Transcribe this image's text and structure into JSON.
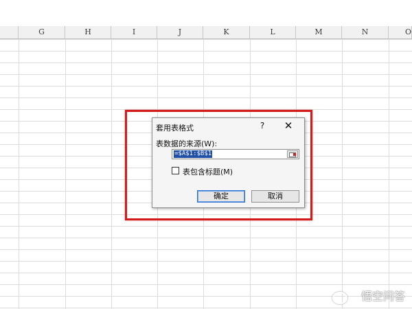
{
  "columns": [
    "G",
    "H",
    "I",
    "J",
    "K",
    "L",
    "M",
    "N",
    "O"
  ],
  "dialog": {
    "title": "套用表格式",
    "help": "?",
    "close": "✕",
    "source_label": "表数据的来源(W):",
    "range_value": "=$A$1:$B$1",
    "checkbox_label": "表包含标题(M)",
    "checkbox_checked": false,
    "ok_label": "确定",
    "cancel_label": "取消"
  },
  "watermark": "悟空问答",
  "colors": {
    "highlight_frame": "#d41b1b",
    "range_selection": "#1f4fa6"
  }
}
